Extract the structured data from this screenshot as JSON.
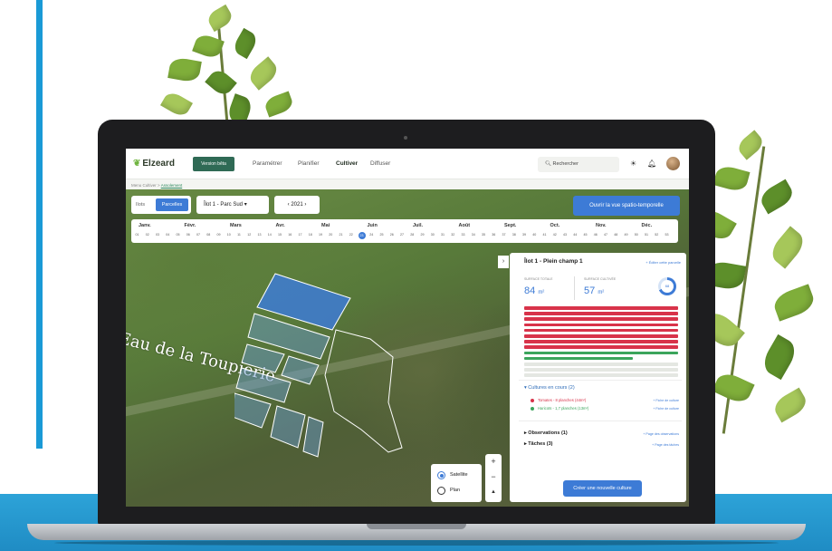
{
  "app": {
    "logo": "Elzeard",
    "beta_label": "Version bêta",
    "nav": [
      "Paramétrer",
      "Planifier",
      "Cultiver",
      "Diffuser"
    ],
    "active_nav": "Cultiver",
    "search_label": "Rechercher",
    "breadcrumb": {
      "parent": "Menu Cultiver",
      "separator": ">",
      "current": "Assolement"
    }
  },
  "toolbar": {
    "tab_ilots": "Ilots",
    "tab_parcelles": "Parcelles",
    "ilot_select": "Îlot 1 - Parc Sud",
    "year": "2021",
    "open_button": "Ouvrir la vue spatio-temporelle"
  },
  "timeline": {
    "months": [
      "Janv.",
      "Févr.",
      "Mars",
      "Avr.",
      "Mai",
      "Juin",
      "Juil.",
      "Août",
      "Sept.",
      "Oct.",
      "Nov.",
      "Déc."
    ],
    "current_week": "23"
  },
  "map": {
    "label": "Eau de la Toupierie"
  },
  "panel": {
    "title": "Îlot 1 - Plein champ 1",
    "edit_link": "+ Éditer cette parcelle",
    "surface_totale_label": "SURFACE TOTALE",
    "surface_totale_value": "84",
    "surface_cultivee_label": "SURFACE CULTIVÉE",
    "surface_cultivee_value": "57",
    "unit": "m²",
    "donut_value": "68",
    "donut_fraction": 0.68,
    "cultures_title": "Cultures en cours (2)",
    "crops": [
      {
        "name": "Tomates - 8 planches (44m²)",
        "color": "#d8334a",
        "link": "+ Fiche de culture"
      },
      {
        "name": "Haricots - 1,7 planches (13m²)",
        "color": "#3ba55c",
        "link": "+ Fiche de culture"
      }
    ],
    "observations_title": "Observations (1)",
    "observations_link": "+ Page des observations",
    "taches_title": "Tâches (3)",
    "taches_link": "+ Page des tâches",
    "create_button": "Créer une nouvelle culture"
  },
  "layers": {
    "satellite": "Satellite",
    "plan": "Plan",
    "selected": "satellite"
  },
  "colors": {
    "accent": "#3d7bd6",
    "brand_green": "#2f6a55",
    "tomato": "#d8334a",
    "bean": "#3ba55c",
    "backdrop_blue": "#1a9ad6"
  }
}
